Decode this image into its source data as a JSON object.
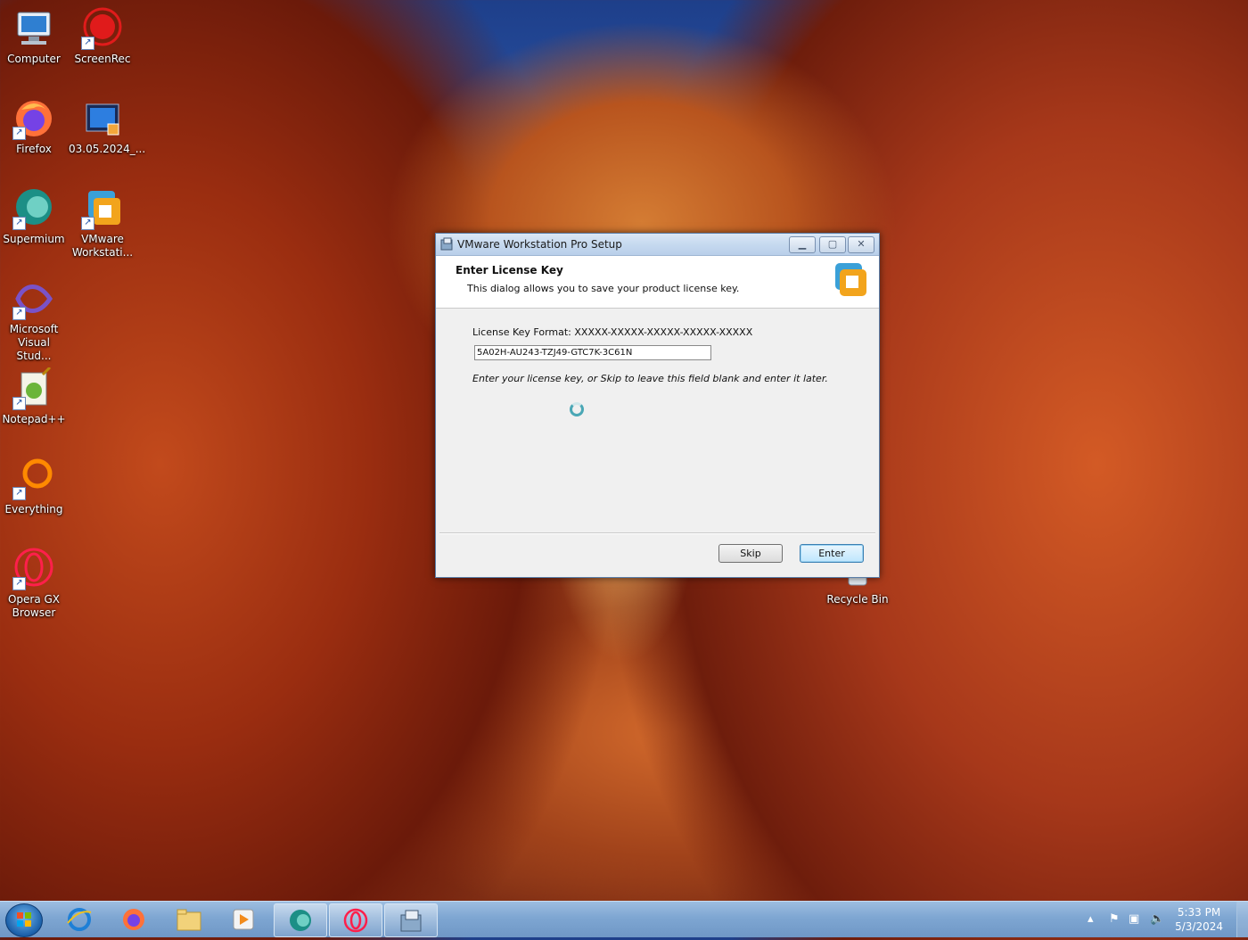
{
  "desktop": {
    "icons": [
      {
        "label": "Computer"
      },
      {
        "label": "ScreenRec"
      },
      {
        "label": "Firefox"
      },
      {
        "label": "03.05.2024_..."
      },
      {
        "label": "Supermium"
      },
      {
        "label": "VMware Workstati..."
      },
      {
        "label": "Microsoft Visual Stud..."
      },
      {
        "label": "Notepad++"
      },
      {
        "label": "Everything"
      },
      {
        "label": "Opera GX Browser"
      },
      {
        "label": "Recycle Bin"
      }
    ]
  },
  "dialog": {
    "title": "VMware Workstation Pro Setup",
    "header_title": "Enter License Key",
    "header_subtitle": "This dialog allows you to save your product license key.",
    "format_label": "License Key Format: XXXXX-XXXXX-XXXXX-XXXXX-XXXXX",
    "license_key_value": "5A02H-AU243-TZJ49-GTC7K-3C61N",
    "hint": "Enter your license key, or Skip to leave this field blank and enter it later.",
    "skip_label": "Skip",
    "enter_label": "Enter"
  },
  "taskbar": {
    "pinned": [
      "Internet Explorer",
      "Firefox",
      "Windows Explorer",
      "Media Player",
      "Supermium",
      "Opera GX",
      "VMware Setup"
    ],
    "clock_time": "5:33 PM",
    "clock_date": "5/3/2024"
  },
  "colors": {
    "titlebar": "#c6d9ef",
    "dialog_bg": "#f0f0f0",
    "taskbar": "#7ea6d2",
    "accent_default_button": "#3c7fb1"
  }
}
